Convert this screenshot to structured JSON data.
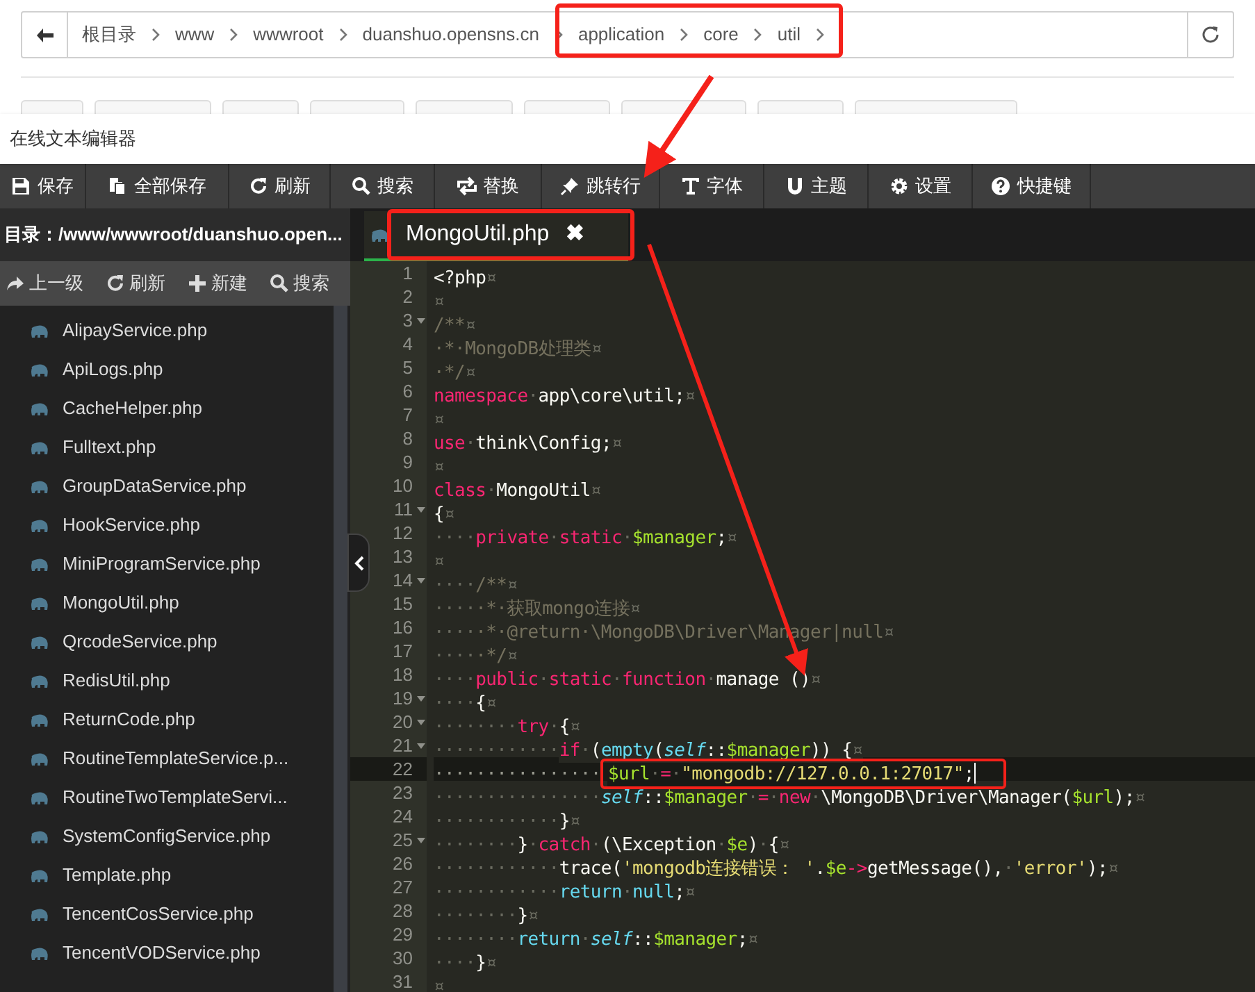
{
  "breadcrumb": {
    "items": [
      "根目录",
      "www",
      "wwwroot",
      "duanshuo.opensns.cn",
      "application",
      "core",
      "util"
    ]
  },
  "editor": {
    "title": "在线文本编辑器",
    "toolbar": [
      "保存",
      "全部保存",
      "刷新",
      "搜索",
      "替换",
      "跳转行",
      "字体",
      "主题",
      "设置",
      "快捷键"
    ],
    "sidebar": {
      "path": "目录：/www/wwwroot/duanshuo.open...",
      "actions": [
        "上一级",
        "刷新",
        "新建",
        "搜索"
      ],
      "files": [
        "AlipayService.php",
        "ApiLogs.php",
        "CacheHelper.php",
        "Fulltext.php",
        "GroupDataService.php",
        "HookService.php",
        "MiniProgramService.php",
        "MongoUtil.php",
        "QrcodeService.php",
        "RedisUtil.php",
        "ReturnCode.php",
        "RoutineTemplateService.p...",
        "RoutineTwoTemplateServi...",
        "SystemConfigService.php",
        "Template.php",
        "TencentCosService.php",
        "TencentVODService.php"
      ]
    },
    "tabs": [
      {
        "label": "MongoUtil.php",
        "close": "✖",
        "selected": true
      }
    ],
    "lines": [
      {
        "number": "1",
        "foldable": false,
        "current": false,
        "tokens": [
          {
            "kind": "plain",
            "text": "<?php"
          },
          {
            "kind": "space",
            "text": "¤"
          }
        ]
      },
      {
        "number": "2",
        "foldable": false,
        "current": false,
        "tokens": [
          {
            "kind": "space",
            "text": "¤"
          }
        ]
      },
      {
        "number": "3",
        "foldable": true,
        "current": false,
        "tokens": [
          {
            "kind": "comment",
            "text": "/**"
          },
          {
            "kind": "space",
            "text": "¤"
          }
        ]
      },
      {
        "number": "4",
        "foldable": false,
        "current": false,
        "tokens": [
          {
            "kind": "comment",
            "text": "·*·MongoDB处理类"
          },
          {
            "kind": "space",
            "text": "¤"
          }
        ]
      },
      {
        "number": "5",
        "foldable": false,
        "current": false,
        "tokens": [
          {
            "kind": "comment",
            "text": "·*/"
          },
          {
            "kind": "space",
            "text": "¤"
          }
        ]
      },
      {
        "number": "6",
        "foldable": false,
        "current": false,
        "tokens": [
          {
            "kind": "keyword",
            "text": "namespace"
          },
          {
            "kind": "space",
            "text": "·"
          },
          {
            "kind": "plain",
            "text": "app\\core\\util;"
          },
          {
            "kind": "space",
            "text": "¤"
          }
        ]
      },
      {
        "number": "7",
        "foldable": false,
        "current": false,
        "tokens": [
          {
            "kind": "space",
            "text": "¤"
          }
        ]
      },
      {
        "number": "8",
        "foldable": false,
        "current": false,
        "tokens": [
          {
            "kind": "keyword",
            "text": "use"
          },
          {
            "kind": "space",
            "text": "·"
          },
          {
            "kind": "plain",
            "text": "think\\Config;"
          },
          {
            "kind": "space",
            "text": "¤"
          }
        ]
      },
      {
        "number": "9",
        "foldable": false,
        "current": false,
        "tokens": [
          {
            "kind": "space",
            "text": "¤"
          }
        ]
      },
      {
        "number": "10",
        "foldable": false,
        "current": false,
        "tokens": [
          {
            "kind": "keyword",
            "text": "class"
          },
          {
            "kind": "space",
            "text": "·"
          },
          {
            "kind": "plain",
            "text": "MongoUtil"
          },
          {
            "kind": "space",
            "text": "¤"
          }
        ]
      },
      {
        "number": "11",
        "foldable": true,
        "current": false,
        "tokens": [
          {
            "kind": "plain",
            "text": "{"
          },
          {
            "kind": "space",
            "text": "¤"
          }
        ]
      },
      {
        "number": "12",
        "foldable": false,
        "current": false,
        "tokens": [
          {
            "kind": "space",
            "text": "····"
          },
          {
            "kind": "keyword",
            "text": "private"
          },
          {
            "kind": "space",
            "text": "·"
          },
          {
            "kind": "keyword",
            "text": "static"
          },
          {
            "kind": "space",
            "text": "·"
          },
          {
            "kind": "variable",
            "text": "$manager"
          },
          {
            "kind": "plain",
            "text": ";"
          },
          {
            "kind": "space",
            "text": "¤"
          }
        ]
      },
      {
        "number": "13",
        "foldable": false,
        "current": false,
        "tokens": [
          {
            "kind": "space",
            "text": "¤"
          }
        ]
      },
      {
        "number": "14",
        "foldable": true,
        "current": false,
        "tokens": [
          {
            "kind": "space",
            "text": "····"
          },
          {
            "kind": "comment",
            "text": "/**"
          },
          {
            "kind": "space",
            "text": "¤"
          }
        ]
      },
      {
        "number": "15",
        "foldable": false,
        "current": false,
        "tokens": [
          {
            "kind": "space",
            "text": "····"
          },
          {
            "kind": "comment",
            "text": "·*·获取mongo连接"
          },
          {
            "kind": "space",
            "text": "¤"
          }
        ]
      },
      {
        "number": "16",
        "foldable": false,
        "current": false,
        "tokens": [
          {
            "kind": "space",
            "text": "····"
          },
          {
            "kind": "comment",
            "text": "·*·@return·\\MongoDB\\Driver\\Manager|null"
          },
          {
            "kind": "space",
            "text": "¤"
          }
        ]
      },
      {
        "number": "17",
        "foldable": false,
        "current": false,
        "tokens": [
          {
            "kind": "space",
            "text": "····"
          },
          {
            "kind": "comment",
            "text": "·*/"
          },
          {
            "kind": "space",
            "text": "¤"
          }
        ]
      },
      {
        "number": "18",
        "foldable": false,
        "current": false,
        "tokens": [
          {
            "kind": "space",
            "text": "····"
          },
          {
            "kind": "keyword",
            "text": "public"
          },
          {
            "kind": "space",
            "text": "·"
          },
          {
            "kind": "keyword",
            "text": "static"
          },
          {
            "kind": "space",
            "text": "·"
          },
          {
            "kind": "keyword",
            "text": "function"
          },
          {
            "kind": "space",
            "text": "·"
          },
          {
            "kind": "plain",
            "text": "manage ()"
          },
          {
            "kind": "space",
            "text": "¤"
          }
        ]
      },
      {
        "number": "19",
        "foldable": true,
        "current": false,
        "tokens": [
          {
            "kind": "space",
            "text": "····"
          },
          {
            "kind": "plain",
            "text": "{"
          },
          {
            "kind": "space",
            "text": "¤"
          }
        ]
      },
      {
        "number": "20",
        "foldable": true,
        "current": false,
        "tokens": [
          {
            "kind": "space",
            "text": "········"
          },
          {
            "kind": "keyword",
            "text": "try"
          },
          {
            "kind": "space",
            "text": "·"
          },
          {
            "kind": "plain",
            "text": "{"
          },
          {
            "kind": "space",
            "text": "¤"
          }
        ]
      },
      {
        "number": "21",
        "foldable": true,
        "current": false,
        "tokens": [
          {
            "kind": "space",
            "text": "············"
          },
          {
            "kind": "keyword",
            "text": "if"
          },
          {
            "kind": "space",
            "text": "·"
          },
          {
            "kind": "plain",
            "text": "("
          },
          {
            "kind": "function",
            "text": "empty"
          },
          {
            "kind": "plain",
            "text": "("
          },
          {
            "kind": "self",
            "text": "self"
          },
          {
            "kind": "plain",
            "text": "::"
          },
          {
            "kind": "variable",
            "text": "$manager"
          },
          {
            "kind": "plain",
            "text": ")) {"
          },
          {
            "kind": "space",
            "text": "¤"
          }
        ]
      },
      {
        "number": "22",
        "foldable": false,
        "current": true,
        "tokens": [
          {
            "kind": "space",
            "text": "················"
          },
          {
            "kind": "variable",
            "text": "$url"
          },
          {
            "kind": "space",
            "text": "·"
          },
          {
            "kind": "keyword",
            "text": "="
          },
          {
            "kind": "space",
            "text": "·"
          },
          {
            "kind": "string",
            "text": "\"mongodb://127.0.0.1:27017\""
          },
          {
            "kind": "plain",
            "text": ";"
          }
        ]
      },
      {
        "number": "23",
        "foldable": false,
        "current": false,
        "tokens": [
          {
            "kind": "space",
            "text": "················"
          },
          {
            "kind": "self",
            "text": "self"
          },
          {
            "kind": "plain",
            "text": "::"
          },
          {
            "kind": "variable",
            "text": "$manager"
          },
          {
            "kind": "space",
            "text": "·"
          },
          {
            "kind": "keyword",
            "text": "="
          },
          {
            "kind": "space",
            "text": "·"
          },
          {
            "kind": "keyword",
            "text": "new"
          },
          {
            "kind": "space",
            "text": "·"
          },
          {
            "kind": "plain",
            "text": "\\MongoDB\\Driver\\Manager("
          },
          {
            "kind": "variable",
            "text": "$url"
          },
          {
            "kind": "plain",
            "text": ");"
          },
          {
            "kind": "space",
            "text": "¤"
          }
        ]
      },
      {
        "number": "24",
        "foldable": false,
        "current": false,
        "tokens": [
          {
            "kind": "space",
            "text": "············"
          },
          {
            "kind": "plain",
            "text": "}"
          },
          {
            "kind": "space",
            "text": "¤"
          }
        ]
      },
      {
        "number": "25",
        "foldable": true,
        "current": false,
        "tokens": [
          {
            "kind": "space",
            "text": "········"
          },
          {
            "kind": "plain",
            "text": "}"
          },
          {
            "kind": "space",
            "text": "·"
          },
          {
            "kind": "keyword",
            "text": "catch"
          },
          {
            "kind": "space",
            "text": "·"
          },
          {
            "kind": "plain",
            "text": "(\\Exception"
          },
          {
            "kind": "space",
            "text": "·"
          },
          {
            "kind": "variable",
            "text": "$e"
          },
          {
            "kind": "plain",
            "text": ")"
          },
          {
            "kind": "space",
            "text": "·"
          },
          {
            "kind": "plain",
            "text": "{"
          },
          {
            "kind": "space",
            "text": "¤"
          }
        ]
      },
      {
        "number": "26",
        "foldable": false,
        "current": false,
        "tokens": [
          {
            "kind": "space",
            "text": "············"
          },
          {
            "kind": "plain",
            "text": "trace("
          },
          {
            "kind": "string",
            "text": "'mongodb连接错误： '"
          },
          {
            "kind": "plain",
            "text": "."
          },
          {
            "kind": "variable",
            "text": "$e"
          },
          {
            "kind": "keyword",
            "text": "->"
          },
          {
            "kind": "plain",
            "text": "getMessage(),"
          },
          {
            "kind": "space",
            "text": "·"
          },
          {
            "kind": "string",
            "text": "'error'"
          },
          {
            "kind": "plain",
            "text": ");"
          },
          {
            "kind": "space",
            "text": "¤"
          }
        ]
      },
      {
        "number": "27",
        "foldable": false,
        "current": false,
        "tokens": [
          {
            "kind": "space",
            "text": "············"
          },
          {
            "kind": "function",
            "text": "return"
          },
          {
            "kind": "space",
            "text": "·"
          },
          {
            "kind": "function",
            "text": "null"
          },
          {
            "kind": "plain",
            "text": ";"
          },
          {
            "kind": "space",
            "text": "¤"
          }
        ]
      },
      {
        "number": "28",
        "foldable": false,
        "current": false,
        "tokens": [
          {
            "kind": "space",
            "text": "········"
          },
          {
            "kind": "plain",
            "text": "}"
          },
          {
            "kind": "space",
            "text": "¤"
          }
        ]
      },
      {
        "number": "29",
        "foldable": false,
        "current": false,
        "tokens": [
          {
            "kind": "space",
            "text": "········"
          },
          {
            "kind": "function",
            "text": "return"
          },
          {
            "kind": "space",
            "text": "·"
          },
          {
            "kind": "self",
            "text": "self"
          },
          {
            "kind": "plain",
            "text": "::"
          },
          {
            "kind": "variable",
            "text": "$manager"
          },
          {
            "kind": "plain",
            "text": ";"
          },
          {
            "kind": "space",
            "text": "¤"
          }
        ]
      },
      {
        "number": "30",
        "foldable": false,
        "current": false,
        "tokens": [
          {
            "kind": "space",
            "text": "····"
          },
          {
            "kind": "plain",
            "text": "}"
          },
          {
            "kind": "space",
            "text": "¤"
          }
        ]
      },
      {
        "number": "31",
        "foldable": false,
        "current": false,
        "tokens": [
          {
            "kind": "space",
            "text": "¤"
          }
        ]
      }
    ]
  }
}
